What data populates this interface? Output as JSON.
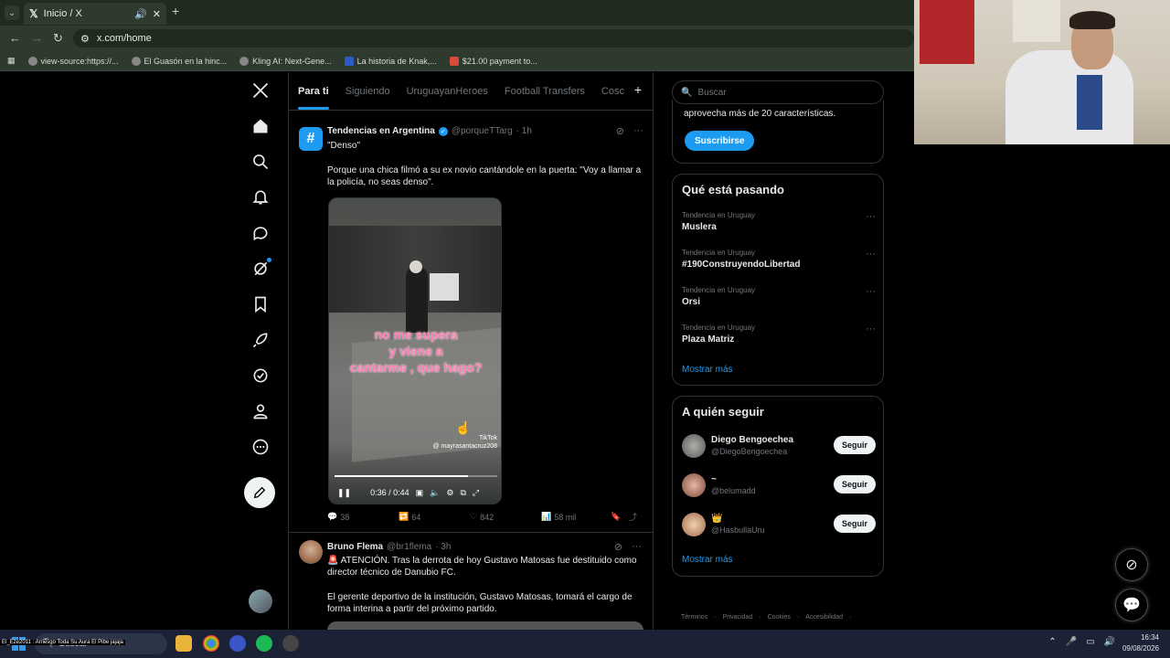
{
  "browser": {
    "tab_title": "Inicio / X",
    "url": "x.com/home",
    "bookmarks": [
      {
        "label": "view-source:https://..."
      },
      {
        "label": "El Guasón en la hinc..."
      },
      {
        "label": "Kling AI: Next-Gene..."
      },
      {
        "label": "La historia de Knak,..."
      },
      {
        "label": "$21.00 payment to..."
      }
    ]
  },
  "feed_tabs": [
    "Para ti",
    "Siguiendo",
    "UruguayanHeroes",
    "Football Transfers",
    "Cosc"
  ],
  "tweet1": {
    "name": "Tendencias en Argentina",
    "handle": "@porqueTTarg",
    "time": "· 1h",
    "line1": "\"Denso\"",
    "line2": "Porque una chica filmó a su ex novio cantándole en la puerta: \"Voy a llamar a la policía, no seas denso\".",
    "video": {
      "caption": "no me supera\ny viene a\ncantarme , que hago?",
      "tiktok": "TikTok",
      "tiktok_user": "@ mayrasantacruz208",
      "time": "0:36 / 0:44",
      "progress": 0.82
    },
    "stats": {
      "replies": "38",
      "retweets": "64",
      "likes": "842",
      "views": "58 mil"
    }
  },
  "tweet2": {
    "name": "Bruno Flema",
    "handle": "@br1flema",
    "time": "· 3h",
    "line1": "🚨 ATENCIÓN. Tras la derrota de hoy Gustavo Matosas fue destituido como director técnico de Danubio FC.",
    "line2": "El gerente deportivo de la institución, Gustavo Matosas, tomará el cargo de forma interina a partir del próximo partido."
  },
  "sidebar": {
    "search_placeholder": "Buscar",
    "premium_text": "aprovecha más de 20 características.",
    "subscribe": "Suscribirse",
    "trends_title": "Qué está pasando",
    "trends": [
      {
        "meta": "Tendencia en Uruguay",
        "topic": "Muslera"
      },
      {
        "meta": "Tendencia en Uruguay",
        "topic": "#190ConstruyendoLibertad"
      },
      {
        "meta": "Tendencia en Uruguay",
        "topic": "Orsi"
      },
      {
        "meta": "Tendencia en Uruguay",
        "topic": "Plaza Matriz"
      }
    ],
    "show_more": "Mostrar más",
    "follow_title": "A quién seguir",
    "follow": [
      {
        "name": "Diego Bengoechea",
        "handle": "@DiegoBengoechea",
        "button": "Seguir"
      },
      {
        "name": "~",
        "handle": "@belumadd",
        "button": "Seguir"
      },
      {
        "name": "👑",
        "handle": "@HasbullaUru",
        "button": "Seguir"
      }
    ],
    "show_more2": "Mostrar más",
    "footer": [
      "Términos",
      "·",
      "Privacidad",
      "·",
      "Cookies",
      "·",
      "Accesibilidad",
      "·"
    ]
  },
  "taskbar": {
    "search": "Buscar",
    "song": "El_Eze2011 : Arriesgo Toda Su Aura El Pibe jajaja",
    "time": "16:34",
    "date": "09/08/2026"
  },
  "colors": {
    "accent": "#1d9bf0",
    "bg": "#000000",
    "border": "#2f3336"
  }
}
